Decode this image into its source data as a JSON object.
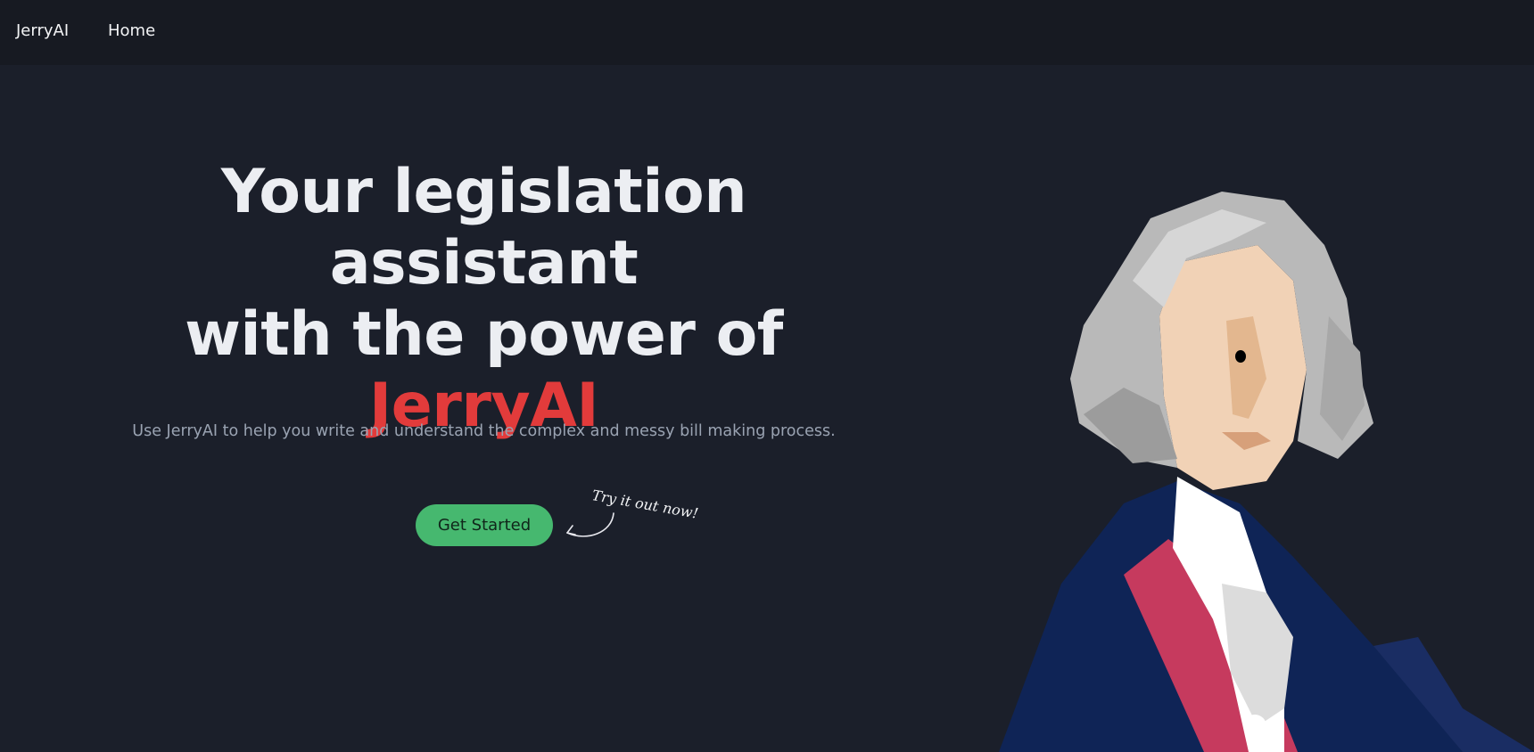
{
  "navbar": {
    "brand": "JerryAI",
    "home_label": "Home"
  },
  "hero": {
    "headline_line1": "Your legislation assistant",
    "headline_line2": "with the power of",
    "headline_accent": "JerryAI",
    "subtitle": "Use JerryAI to help you write and understand the complex and messy bill making process.",
    "cta_label": "Get Started",
    "note": "Try it out now!"
  },
  "colors": {
    "background": "#1b1f2a",
    "navbar": "#171a22",
    "accent": "#e23b3b",
    "button": "#46b86f"
  },
  "icons": {
    "arrow": "curved-arrow-icon",
    "portrait": "george-washington-illustration"
  }
}
